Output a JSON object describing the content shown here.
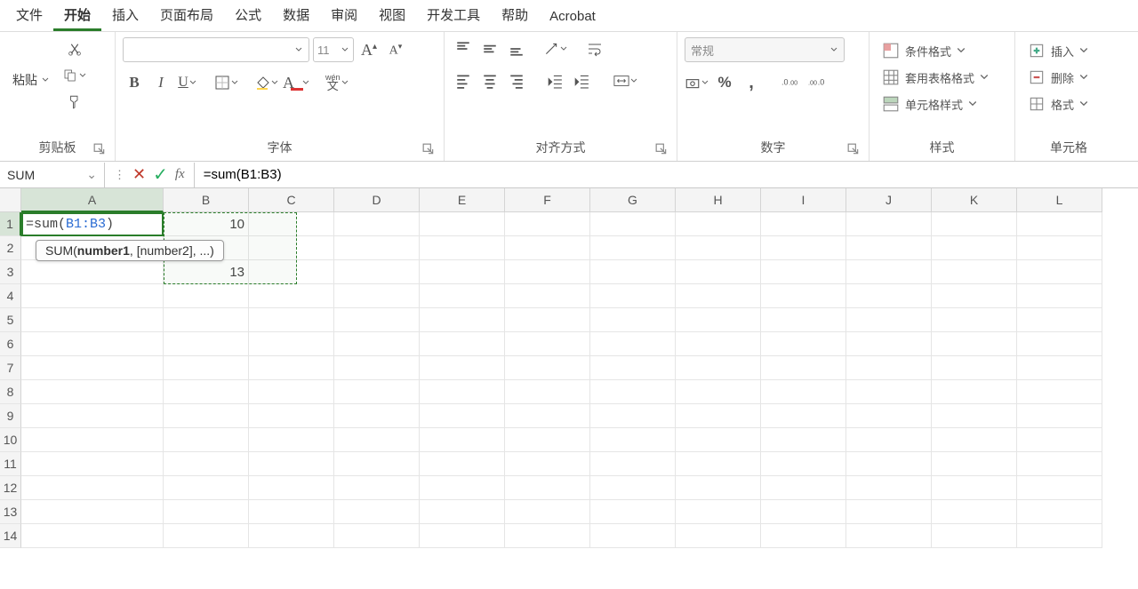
{
  "menu": {
    "items": [
      "文件",
      "开始",
      "插入",
      "页面布局",
      "公式",
      "数据",
      "审阅",
      "视图",
      "开发工具",
      "帮助",
      "Acrobat"
    ],
    "active": 1
  },
  "ribbon": {
    "clipboard": {
      "paste": "粘贴",
      "label": "剪贴板"
    },
    "font": {
      "label": "字体",
      "name": "",
      "size": "11",
      "bold": "B",
      "italic": "I",
      "underline": "U",
      "wen": "wén",
      "wenSub": "文"
    },
    "align": {
      "label": "对齐方式"
    },
    "number": {
      "label": "数字",
      "format": "常规",
      "percent": "%",
      "comma": ","
    },
    "styles": {
      "label": "样式",
      "cond": "条件格式",
      "table": "套用表格格式",
      "cell": "单元格样式"
    },
    "cells": {
      "label": "单元格",
      "insert": "插入",
      "delete": "删除",
      "format": "格式"
    }
  },
  "formulaBar": {
    "name": "SUM",
    "formula": "=sum(B1:B3)",
    "fx": "fx"
  },
  "sheet": {
    "cols": [
      "A",
      "B",
      "C",
      "D",
      "E",
      "F",
      "G",
      "H",
      "I",
      "J",
      "K",
      "L"
    ],
    "rowCount": 14,
    "editingCell": {
      "prefix": "=sum(",
      "ref": "B1:B3",
      "suffix": ")"
    },
    "data": {
      "B1": "10",
      "B2": "",
      "B3": "13"
    },
    "tooltip": {
      "fn": "SUM",
      "p1": "number1",
      "rest": ", [number2], ...)"
    }
  }
}
